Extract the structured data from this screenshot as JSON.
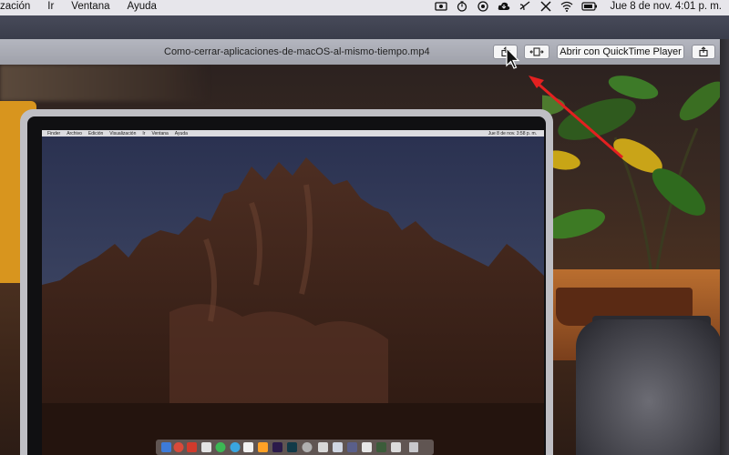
{
  "menubar": {
    "items": [
      "zación",
      "Ir",
      "Ventana",
      "Ayuda"
    ],
    "status_icons": [
      "screen-record-icon",
      "timer-icon",
      "user-circle-icon",
      "cloud-icon",
      "airplay-icon",
      "scissors-icon",
      "wifi-icon",
      "battery-icon"
    ],
    "clock": "Jue 8 de nov.  4:01 p. m."
  },
  "player": {
    "title": "Como-cerrar-aplicaciones-de-macOS-al-mismo-tiempo.mp4",
    "open_button": "Abrir con QuickTime Player"
  },
  "embedded_screen": {
    "menu": [
      "Finder",
      "Archivo",
      "Edición",
      "Visualización",
      "Ir",
      "Ventana",
      "Ayuda"
    ],
    "clock": "Jue 8 de nov.  3:58 p. m."
  },
  "colors": {
    "annotation_arrow": "#e32020",
    "menubar_bg": "#e7e6eb",
    "titlebar_bg": "#aeb0b9"
  }
}
